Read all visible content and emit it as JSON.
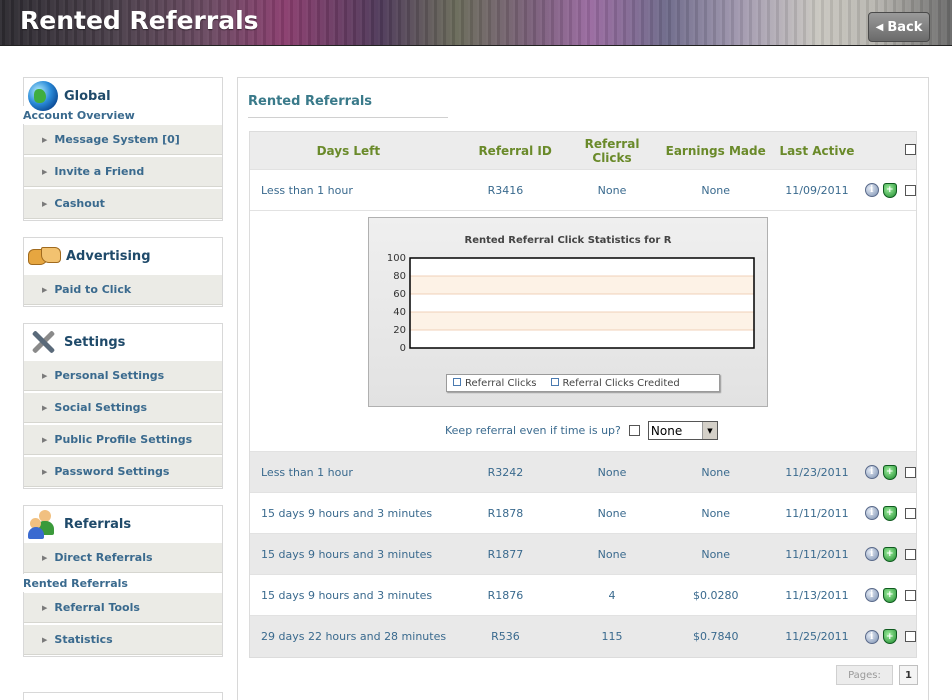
{
  "header": {
    "title": "Rented Referrals",
    "back_label": "Back"
  },
  "sidebar": {
    "global": {
      "title": "Global",
      "sub": "Account Overview",
      "items": [
        "Message System [0]",
        "Invite a Friend",
        "Cashout"
      ]
    },
    "advertising": {
      "title": "Advertising",
      "items": [
        "Paid to Click"
      ]
    },
    "settings": {
      "title": "Settings",
      "items": [
        "Personal Settings",
        "Social Settings",
        "Public Profile Settings",
        "Password Settings"
      ]
    },
    "referrals": {
      "title": "Referrals",
      "items": [
        "Direct Referrals"
      ],
      "sub": "Rented Referrals",
      "items2": [
        "Referral Tools",
        "Statistics"
      ]
    }
  },
  "main": {
    "title": "Rented Referrals",
    "columns": [
      "Days Left",
      "Referral ID",
      "Referral Clicks",
      "Earnings Made",
      "Last Active"
    ],
    "rows": [
      {
        "days": "Less than 1 hour",
        "id": "R3416",
        "clicks": "None",
        "earnings": "None",
        "last": "11/09/2011"
      },
      {
        "days": "Less than 1 hour",
        "id": "R3242",
        "clicks": "None",
        "earnings": "None",
        "last": "11/23/2011"
      },
      {
        "days": "15 days 9 hours and 3 minutes",
        "id": "R1878",
        "clicks": "None",
        "earnings": "None",
        "last": "11/11/2011"
      },
      {
        "days": "15 days 9 hours and 3 minutes",
        "id": "R1877",
        "clicks": "None",
        "earnings": "None",
        "last": "11/11/2011"
      },
      {
        "days": "15 days 9 hours and 3 minutes",
        "id": "R1876",
        "clicks": "4",
        "earnings": "$0.0280",
        "last": "11/13/2011"
      },
      {
        "days": "29 days 22 hours and 28 minutes",
        "id": "R536",
        "clicks": "115",
        "earnings": "$0.7840",
        "last": "11/25/2011"
      }
    ],
    "keep_label": "Keep referral even if time is up?",
    "keep_select_value": "None",
    "pager": {
      "label": "Pages:",
      "current": "1"
    }
  },
  "chart_data": {
    "type": "line",
    "title": "Rented Referral Click Statistics for R",
    "ylim": [
      0,
      100
    ],
    "yticks": [
      "100",
      "80",
      "60",
      "40",
      "20",
      "0"
    ],
    "series": [
      {
        "name": "Referral Clicks",
        "values": []
      },
      {
        "name": "Referral Clicks Credited",
        "values": []
      }
    ],
    "grid": true,
    "legend": "bottom"
  }
}
